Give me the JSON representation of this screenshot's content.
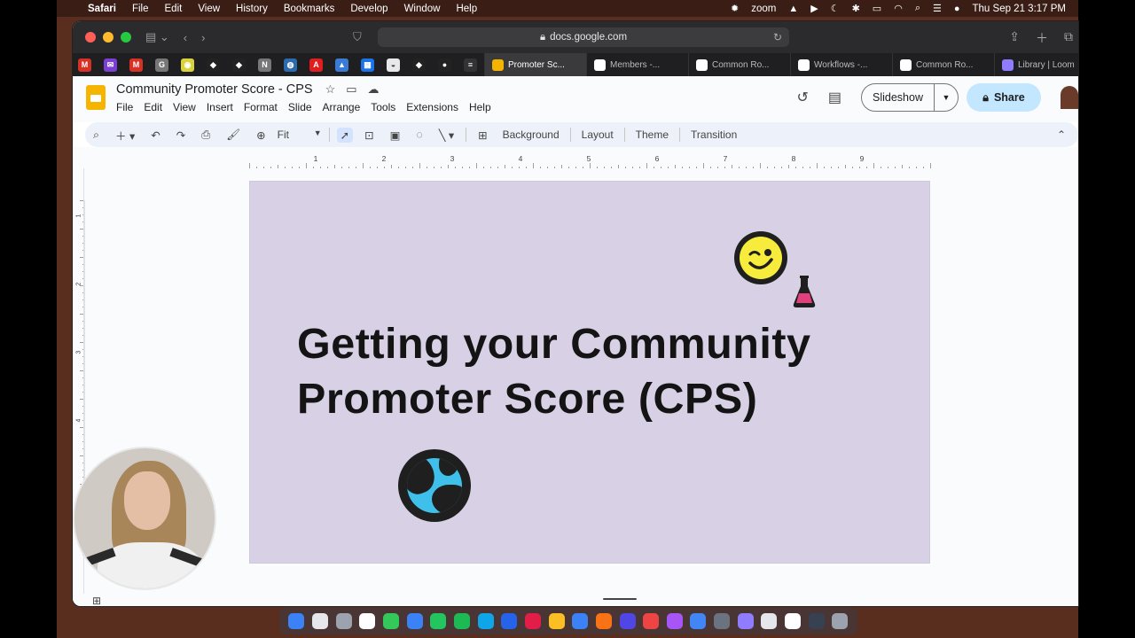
{
  "menubar": {
    "app": "Safari",
    "items": [
      "File",
      "Edit",
      "View",
      "History",
      "Bookmarks",
      "Develop",
      "Window",
      "Help"
    ],
    "zoom_label": "zoom",
    "datetime": "Thu Sep 21  3:17 PM"
  },
  "browser": {
    "url": "docs.google.com",
    "tabs": [
      {
        "label": "Promoter Sc...",
        "color": "#f4b400"
      },
      {
        "label": "Members -...",
        "color": "#ffffff"
      },
      {
        "label": "Common Ro...",
        "color": "#ffffff"
      },
      {
        "label": "Workflows -...",
        "color": "#ffffff"
      },
      {
        "label": "Common Ro...",
        "color": "#ffffff"
      },
      {
        "label": "Library | Loom",
        "color": "#8f7cff"
      }
    ],
    "favorites": [
      {
        "icon": "gmail-icon",
        "color": "#d93025",
        "glyph": "M"
      },
      {
        "icon": "mail-icon",
        "color": "#7b3fd3",
        "glyph": "✉"
      },
      {
        "icon": "gmail-icon",
        "color": "#d93025",
        "glyph": "M"
      },
      {
        "icon": "google-icon",
        "color": "#777777",
        "glyph": "G"
      },
      {
        "icon": "bird-icon",
        "color": "#d9d23a",
        "glyph": "◉"
      },
      {
        "icon": "diamond-icon",
        "color": "#222222",
        "glyph": "◆"
      },
      {
        "icon": "diamond-icon",
        "color": "#222222",
        "glyph": "◆"
      },
      {
        "icon": "notion-icon",
        "color": "#777777",
        "glyph": "N"
      },
      {
        "icon": "globe-icon",
        "color": "#2b6cb0",
        "glyph": "◍"
      },
      {
        "icon": "adobe-icon",
        "color": "#e11d1d",
        "glyph": "A"
      },
      {
        "icon": "image-icon",
        "color": "#3a7bd5",
        "glyph": "▲"
      },
      {
        "icon": "blocks-icon",
        "color": "#1a73e8",
        "glyph": "▦"
      },
      {
        "icon": "drive-icon",
        "color": "#e8e8e8",
        "glyph": "◒"
      },
      {
        "icon": "diamond-icon",
        "color": "#222222",
        "glyph": "◆"
      },
      {
        "icon": "circle-icon",
        "color": "#222222",
        "glyph": "●"
      },
      {
        "icon": "layers-icon",
        "color": "#333333",
        "glyph": "≡"
      }
    ]
  },
  "doc": {
    "title": "Community Promoter Score - CPS",
    "menus": [
      "File",
      "Edit",
      "View",
      "Insert",
      "Format",
      "Slide",
      "Arrange",
      "Tools",
      "Extensions",
      "Help"
    ],
    "slideshow_label": "Slideshow",
    "share_label": "Share"
  },
  "toolbar": {
    "zoom_value": "Fit",
    "buttons": [
      "Background",
      "Layout",
      "Theme",
      "Transition"
    ]
  },
  "ruler": {
    "marks": [
      "1",
      "2",
      "3",
      "4",
      "5",
      "6",
      "7",
      "8",
      "9"
    ],
    "vmarks": [
      "1",
      "2",
      "3",
      "4"
    ]
  },
  "slide": {
    "title_line1": "Getting your Community",
    "title_line2": "Promoter Score (CPS)",
    "background": "#d8d0e5"
  }
}
